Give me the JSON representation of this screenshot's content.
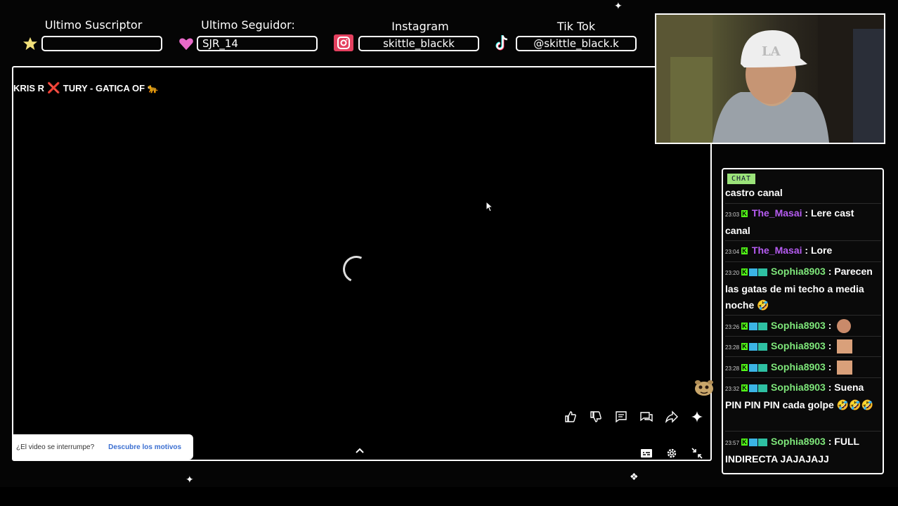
{
  "stats": [
    {
      "title": "Ultimo Suscriptor",
      "value": "",
      "icon": "star-icon"
    },
    {
      "title": "Ultimo Seguidor:",
      "value": "SJR_14",
      "icon": "heart-icon"
    },
    {
      "title": "Instagram",
      "value": "skittle_blackk",
      "icon": "instagram-icon"
    },
    {
      "title": "Tik Tok",
      "value": "@skittle_black.k",
      "icon": "tiktok-icon"
    }
  ],
  "video": {
    "title_left": "KRIS R",
    "title_x": "❌",
    "title_right": "TURY - GATICA OF 🐆",
    "hint_question": "¿El video se interrumpe?",
    "hint_link": "Descubre los motivos"
  },
  "chat": {
    "label": "CHAT",
    "messages": [
      {
        "time": "",
        "user": "",
        "text": "castro canal"
      },
      {
        "time": "23:03",
        "user": "The_Masai",
        "text": ": Lere cast canal"
      },
      {
        "time": "23:04",
        "user": "The_Masai",
        "text": ": Lore"
      },
      {
        "time": "23:20",
        "user": "Sophia8903",
        "text": ": Parecen las gatas de mi techo a media noche 🤣"
      },
      {
        "time": "23:26",
        "user": "Sophia8903",
        "text": ":"
      },
      {
        "time": "23:28",
        "user": "Sophia8903",
        "text": ":"
      },
      {
        "time": "23:28",
        "user": "Sophia8903",
        "text": ":"
      },
      {
        "time": "23:32",
        "user": "Sophia8903",
        "text": ": Suena PIN PIN PIN cada golpe 🤣🤣🤣"
      },
      {
        "time": "23:57",
        "user": "Sophia8903",
        "text": ": FULL INDIRECTA JAJAJAJJ"
      }
    ]
  },
  "colors": {
    "masai": "#b65cf2",
    "sophia": "#7ee67a",
    "chat_label_bg": "#9be37a",
    "title_x": "#e63232"
  }
}
